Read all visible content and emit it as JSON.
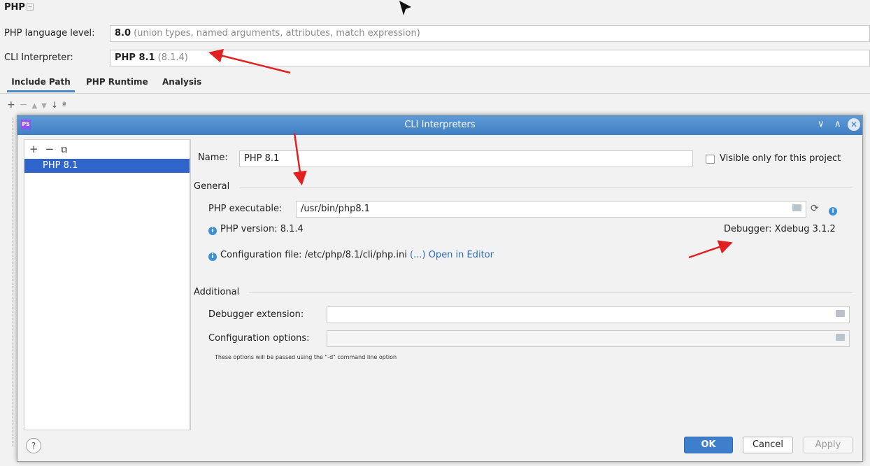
{
  "settings": {
    "section_title": "PHP",
    "language_level_label": "PHP language level:",
    "language_level_value": "8.0",
    "language_level_desc": "(union types, named arguments, attributes, match expression)",
    "cli_label": "CLI Interpreter:",
    "cli_value": "PHP 8.1",
    "cli_version": "(8.1.4)",
    "tabs": [
      {
        "label": "Include Path"
      },
      {
        "label": "PHP Runtime"
      },
      {
        "label": "Analysis"
      }
    ],
    "toolbar_icons": [
      "plus-icon",
      "minus-icon",
      "arrow-up-icon",
      "arrow-down-icon",
      "sort-icon"
    ]
  },
  "dialog": {
    "title": "CLI Interpreters",
    "list_toolbar": {
      "add": "+",
      "remove": "−",
      "copy": "⧉"
    },
    "interpreters": [
      {
        "label": "PHP 8.1"
      }
    ],
    "name_label": "Name:",
    "name_value": "PHP 8.1",
    "visible_only_label": "Visible only for this project",
    "general_title": "General",
    "php_exe_label": "PHP executable:",
    "php_exe_value": "/usr/bin/php8.1",
    "php_version_text": "PHP version: 8.1.4",
    "debugger_text": "Debugger: Xdebug 3.1.2",
    "config_file_text": "Configuration file: /etc/php/8.1/cli/php.ini",
    "config_file_more": "(...)",
    "open_in_editor": "Open in Editor",
    "additional_title": "Additional",
    "debugger_ext_label": "Debugger extension:",
    "debugger_ext_value": "",
    "config_options_label": "Configuration options:",
    "config_options_value": "",
    "options_hint": "These options will be passed using the \"-d\" command line option",
    "help": "?",
    "ok": "OK",
    "cancel": "Cancel",
    "apply": "Apply"
  },
  "colors": {
    "accent": "#3d7fcb",
    "titlebar": "#4a88cc",
    "selection": "#2f65ca",
    "annotation_arrow": "#e32020"
  }
}
